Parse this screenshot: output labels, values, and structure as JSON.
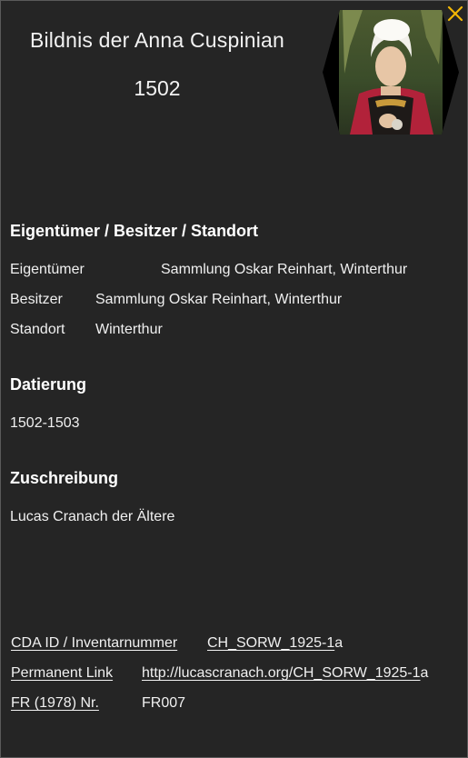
{
  "header": {
    "title": "Bildnis der Anna Cuspinian",
    "year": "1502",
    "close_icon": "close-x-icon",
    "accent_color": "#f2b705"
  },
  "thumbnail": {
    "shape": "hexagon",
    "subject": "portrait painting thumbnail"
  },
  "ownership": {
    "heading": "Eigentümer / Besitzer / Standort",
    "owner_label": "Eigentümer",
    "owner_value": "Sammlung Oskar Reinhart, Winterthur",
    "holder_label": "Besitzer",
    "holder_value": "Sammlung Oskar Reinhart, Winterthur",
    "location_label": "Standort",
    "location_value": "Winterthur"
  },
  "dating": {
    "heading": "Datierung",
    "value": "1502-1503"
  },
  "attribution": {
    "heading": "Zuschreibung",
    "value": "Lucas Cranach der Ältere"
  },
  "references": {
    "cda_label": "CDA ID / Inventarnummer",
    "cda_value_underlined": "CH_SORW_1925-1",
    "cda_value_rest": "a",
    "permalink_label": "Permanent Link",
    "permalink_value_underlined": "http://lucascranach.org/CH_SORW_1925-1",
    "permalink_value_rest": "a",
    "fr_label": "FR (1978) Nr.",
    "fr_value": "FR007"
  }
}
